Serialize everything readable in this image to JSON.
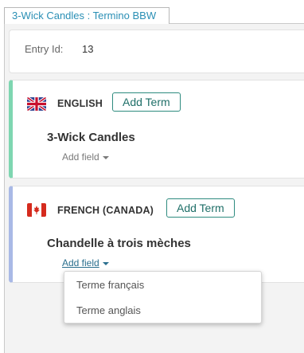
{
  "tab": {
    "title": "3-Wick Candles : Termino BBW"
  },
  "entry": {
    "label": "Entry Id:",
    "value": "13"
  },
  "languages": [
    {
      "name": "ENGLISH",
      "flag_icon": "uk-flag-icon",
      "add_term_label": "Add Term",
      "term": "3-Wick Candles",
      "add_field_label": "Add field",
      "accent_color": "#7ed6b1"
    },
    {
      "name": "FRENCH (CANADA)",
      "flag_icon": "canada-flag-icon",
      "add_term_label": "Add Term",
      "term": "Chandelle à trois mèches",
      "add_field_label": "Add field",
      "accent_color": "#a9b9e6"
    }
  ],
  "add_field_dropdown": {
    "options": [
      "Terme français",
      "Terme anglais"
    ]
  }
}
